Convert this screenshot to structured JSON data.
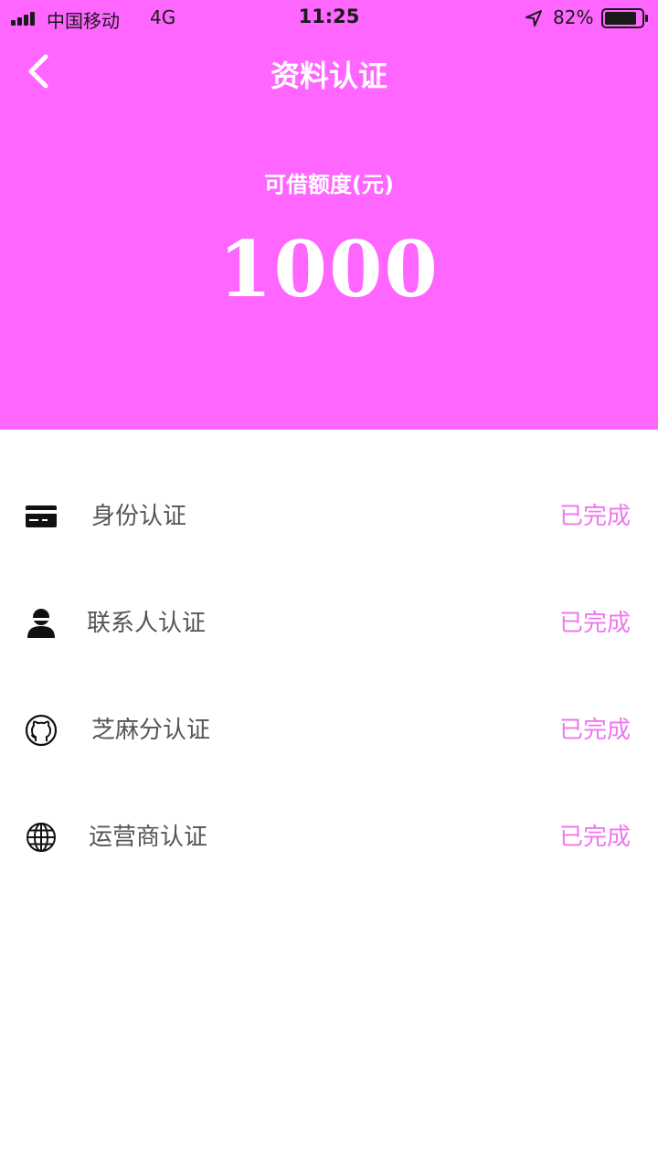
{
  "status_bar": {
    "carrier": "中国移动",
    "network": "4G",
    "time": "11:25",
    "battery": "82%"
  },
  "nav": {
    "title": "资料认证",
    "back_icon": "chevron-left-icon"
  },
  "credit": {
    "label": "可借额度(元)",
    "amount": "1000"
  },
  "verifications": [
    {
      "label": "身份认证",
      "status": "已完成",
      "icon": "id-card-icon"
    },
    {
      "label": "联系人认证",
      "status": "已完成",
      "icon": "contact-person-icon"
    },
    {
      "label": "芝麻分认证",
      "status": "已完成",
      "icon": "github-cat-icon"
    },
    {
      "label": "运营商认证",
      "status": "已完成",
      "icon": "globe-icon"
    }
  ],
  "colors": {
    "header_bg": "#ff66ff",
    "status_text": "#ee77ee",
    "label_text": "#555555"
  }
}
